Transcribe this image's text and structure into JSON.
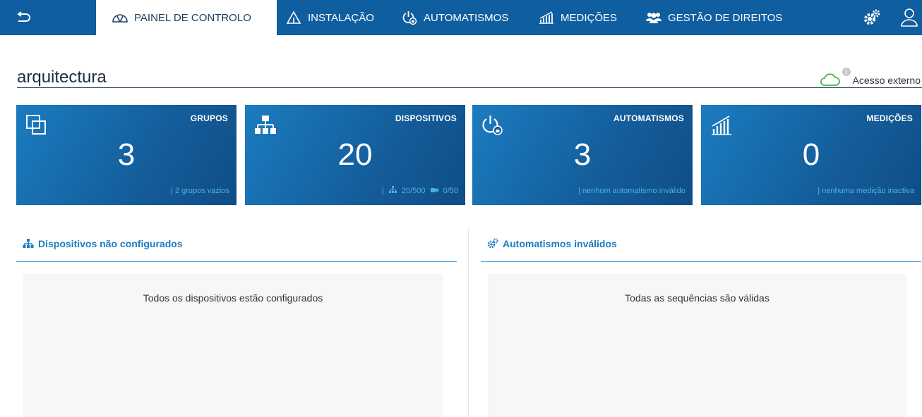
{
  "nav": {
    "back_icon": "back-arrow-icon",
    "tabs": [
      {
        "label": "PAINEL DE CONTROLO",
        "icon": "dashboard-gauge-icon",
        "active": true
      },
      {
        "label": "INSTALAÇÃO",
        "icon": "house-icon",
        "active": false
      },
      {
        "label": "AUTOMATISMOS",
        "icon": "power-lock-icon",
        "active": false
      },
      {
        "label": "MEDIÇÕES",
        "icon": "bar-chart-icon",
        "active": false
      },
      {
        "label": "GESTÃO DE DIREITOS",
        "icon": "users-icon",
        "active": false
      }
    ],
    "settings_icon": "gears-icon",
    "user_icon": "user-icon"
  },
  "header": {
    "title": "arquitectura",
    "external_access": {
      "label": "Acesso externo",
      "icon": "cloud-icon",
      "info_icon": "info-icon",
      "status_color": "#5cb85c"
    }
  },
  "cards": [
    {
      "title": "GRUPOS",
      "value": "3",
      "icon": "groups-icon",
      "footer": "| 2 grupos vazios"
    },
    {
      "title": "DISPOSITIVOS",
      "value": "20",
      "icon": "network-tree-icon",
      "footer_sep": "|",
      "footer_devices": "20/500",
      "footer_cameras": "0/50"
    },
    {
      "title": "AUTOMATISMOS",
      "value": "3",
      "icon": "power-lock-icon",
      "footer": "| nenhum automatismo inválido"
    },
    {
      "title": "MEDIÇÕES",
      "value": "0",
      "icon": "bar-chart-icon",
      "footer": "| nenhuma medição inactiva"
    }
  ],
  "panels": {
    "left": {
      "title": "Dispositivos não configurados",
      "icon": "network-tree-icon",
      "message": "Todos os dispositivos estão configurados"
    },
    "right": {
      "title": "Automatismos inválidos",
      "icon": "gears-icon",
      "message": "Todas as sequências são válidas"
    }
  },
  "colors": {
    "nav_bg": "#0f5ea0",
    "card_bg": "#145d9a",
    "accent": "#1a7bc2",
    "footer_text": "#4fb0e8"
  }
}
